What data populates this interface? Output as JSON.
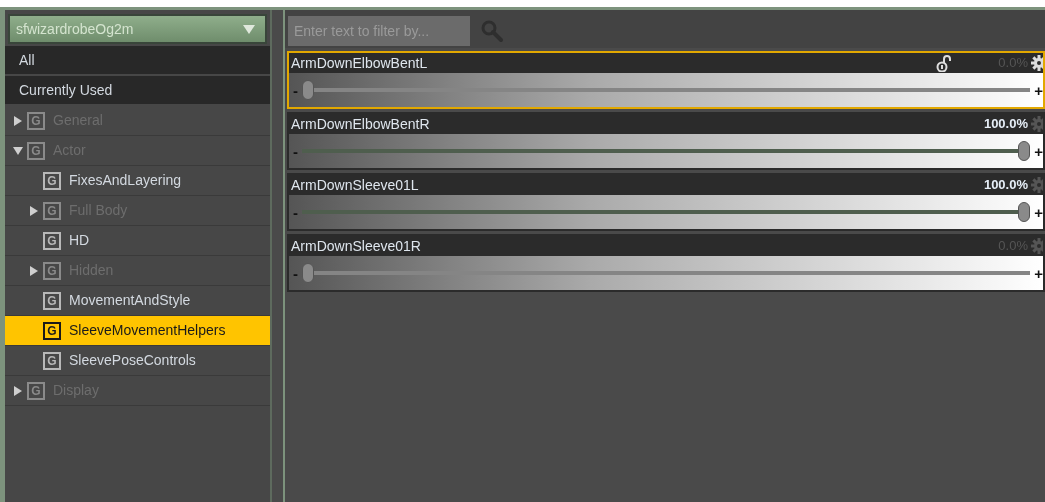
{
  "preset_dropdown": {
    "value": "sfwizardrobeOg2m"
  },
  "tree": [
    {
      "label": "All",
      "kind": "filter",
      "selected": false,
      "dimmed": false
    },
    {
      "label": "Currently Used",
      "kind": "filter",
      "selected": false,
      "dimmed": false
    },
    {
      "label": "General",
      "kind": "group",
      "badge": "G",
      "selected": false,
      "dimmed": true,
      "expanded": false
    },
    {
      "label": "Actor",
      "kind": "group",
      "badge": "G",
      "selected": false,
      "dimmed": true,
      "expanded": true,
      "children": [
        {
          "label": "FixesAndLayering",
          "kind": "group",
          "badge": "G",
          "selected": false,
          "dimmed": false
        },
        {
          "label": "Full Body",
          "kind": "group",
          "badge": "G",
          "selected": false,
          "dimmed": true,
          "expanded": false
        },
        {
          "label": "HD",
          "kind": "group",
          "badge": "G",
          "selected": false,
          "dimmed": false
        },
        {
          "label": "Hidden",
          "kind": "group",
          "badge": "G",
          "selected": false,
          "dimmed": true,
          "expanded": false
        },
        {
          "label": "MovementAndStyle",
          "kind": "group",
          "badge": "G",
          "selected": false,
          "dimmed": false
        },
        {
          "label": "SleeveMovementHelpers",
          "kind": "group",
          "badge": "G",
          "selected": true,
          "dimmed": false
        },
        {
          "label": "SleevePoseControls",
          "kind": "group",
          "badge": "G",
          "selected": false,
          "dimmed": false
        }
      ]
    },
    {
      "label": "Display",
      "kind": "group",
      "badge": "G",
      "selected": false,
      "dimmed": true,
      "expanded": false
    }
  ],
  "filter": {
    "placeholder": "Enter text to filter by..."
  },
  "parameters": [
    {
      "name": "ArmDownElbowBentL",
      "reading": "0.0%",
      "level": 0,
      "selected": true,
      "unlocked": true,
      "decrement": "-",
      "increment": "+"
    },
    {
      "name": "ArmDownElbowBentR",
      "reading": "100.0%",
      "level": 1,
      "selected": false,
      "unlocked": false,
      "decrement": "-",
      "increment": "+"
    },
    {
      "name": "ArmDownSleeve01L",
      "reading": "100.0%",
      "level": 1,
      "selected": false,
      "unlocked": false,
      "decrement": "-",
      "increment": "+"
    },
    {
      "name": "ArmDownSleeve01R",
      "reading": "0.0%",
      "level": 0,
      "selected": false,
      "unlocked": false,
      "decrement": "-",
      "increment": "+"
    }
  ]
}
